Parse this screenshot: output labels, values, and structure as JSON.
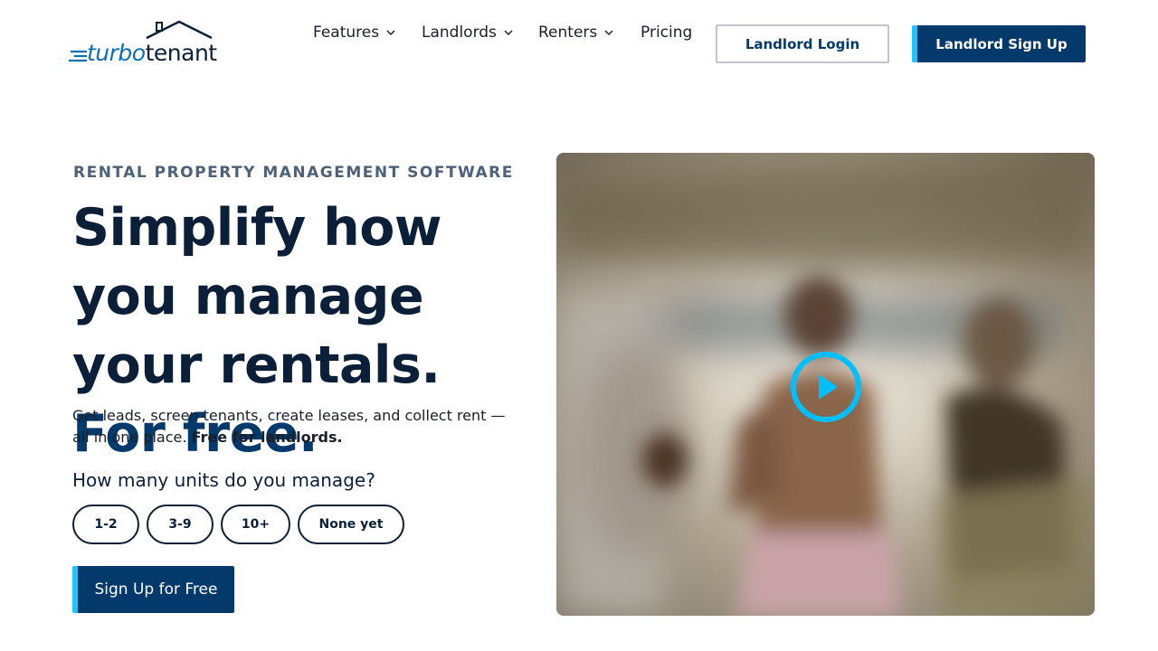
{
  "header": {
    "logo": {
      "part1": "turbo",
      "part2": "tenant"
    },
    "nav": [
      {
        "label": "Features",
        "has_dropdown": true
      },
      {
        "label": "Landlords",
        "has_dropdown": true
      },
      {
        "label": "Renters",
        "has_dropdown": true
      },
      {
        "label": "Pricing",
        "has_dropdown": false
      }
    ],
    "login_label": "Landlord Login",
    "signup_label": "Landlord Sign Up"
  },
  "hero": {
    "eyebrow": "RENTAL PROPERTY MANAGEMENT SOFTWARE",
    "headline_main": "Simplify how you manage your rentals.",
    "headline_accent": "For free.",
    "subtext": "Get leads, screen tenants, create leases, and collect rent — all in one place.",
    "subtext_bold": "Free for landlords.",
    "question": "How many units do you manage?",
    "unit_options": [
      "1-2",
      "3-9",
      "10+",
      "None yet"
    ],
    "cta_label": "Sign Up for Free"
  },
  "video": {
    "play_icon": "play-icon"
  },
  "colors": {
    "navy": "#033a6b",
    "accent_cyan": "#1ec3ff",
    "text_dark": "#0b2038",
    "eyebrow_gray": "#4d6178"
  }
}
